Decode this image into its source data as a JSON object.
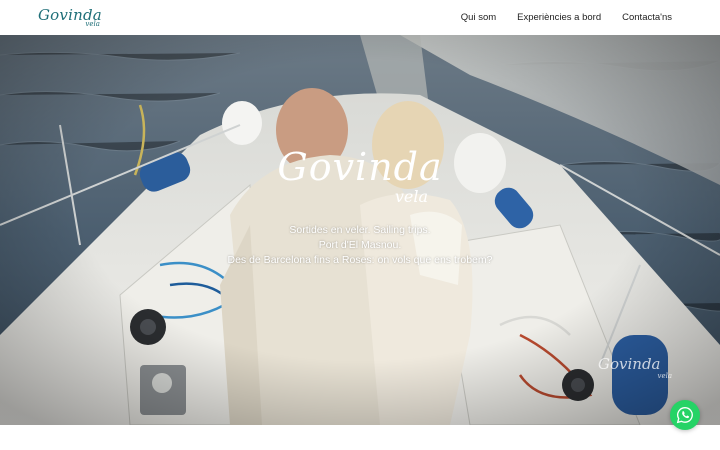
{
  "header": {
    "logo_main": "Govinda",
    "logo_sub": "vela",
    "nav": [
      {
        "label": "Qui som"
      },
      {
        "label": "Experiències a bord"
      },
      {
        "label": "Contacta'ns"
      }
    ]
  },
  "hero": {
    "logo_main": "Govinda",
    "logo_sub": "vela",
    "lines": [
      "Sortides en veler. Sailing trips.",
      "Port d'El Masnou.",
      "Des de Barcelona fins a Roses: on vols que ens trobem?"
    ],
    "watermark_main": "Govinda",
    "watermark_sub": "vela"
  },
  "floating": {
    "icon": "whatsapp-icon"
  },
  "colors": {
    "brand": "#1f6f78",
    "whatsapp": "#25d366",
    "sea": "#4a5d6e",
    "deck": "#e9e8e3"
  }
}
